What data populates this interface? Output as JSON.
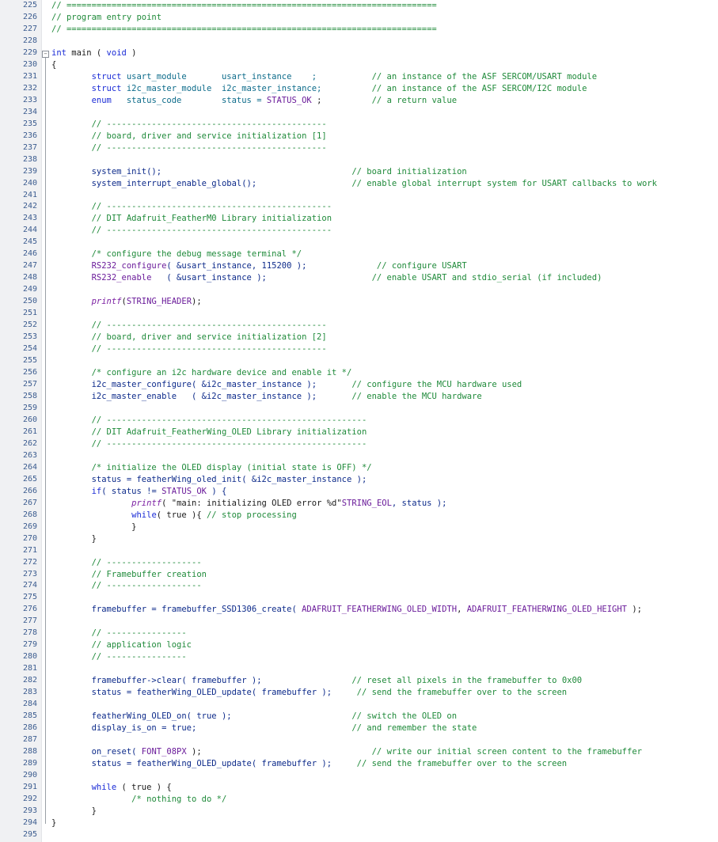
{
  "editor": {
    "lines": [
      {
        "n": "225",
        "tokens": [
          {
            "t": "// ==========================================================================",
            "c": "comment"
          }
        ]
      },
      {
        "n": "226",
        "tokens": [
          {
            "t": "// program entry point",
            "c": "comment"
          }
        ]
      },
      {
        "n": "227",
        "tokens": [
          {
            "t": "// ==========================================================================",
            "c": "comment"
          }
        ]
      },
      {
        "n": "228",
        "tokens": []
      },
      {
        "n": "229",
        "fold": "−",
        "tokens": [
          {
            "t": "int",
            "c": "keyword"
          },
          {
            "t": " main ( ",
            "c": "ident"
          },
          {
            "t": "void",
            "c": "keyword"
          },
          {
            "t": " )",
            "c": "ident"
          }
        ]
      },
      {
        "n": "230",
        "tokens": [
          {
            "t": "{",
            "c": "ident"
          }
        ]
      },
      {
        "n": "231",
        "tokens": [
          {
            "t": "        ",
            "c": "ident"
          },
          {
            "t": "struct",
            "c": "keyword"
          },
          {
            "t": " usart_module       usart_instance    ;           ",
            "c": "type"
          },
          {
            "t": "// an instance of the ASF SERCOM/USART module",
            "c": "comment"
          }
        ]
      },
      {
        "n": "232",
        "tokens": [
          {
            "t": "        ",
            "c": "ident"
          },
          {
            "t": "struct",
            "c": "keyword"
          },
          {
            "t": " i2c_master_module  i2c_master_instance;          ",
            "c": "type"
          },
          {
            "t": "// an instance of the ASF SERCOM/I2C module",
            "c": "comment"
          }
        ]
      },
      {
        "n": "233",
        "tokens": [
          {
            "t": "        ",
            "c": "ident"
          },
          {
            "t": "enum",
            "c": "keyword"
          },
          {
            "t": "   status_code        status = ",
            "c": "type"
          },
          {
            "t": "STATUS_OK",
            "c": "macro"
          },
          {
            "t": " ;          ",
            "c": "ident"
          },
          {
            "t": "// a return value",
            "c": "comment"
          }
        ]
      },
      {
        "n": "234",
        "tokens": []
      },
      {
        "n": "235",
        "tokens": [
          {
            "t": "        ",
            "c": "ident"
          },
          {
            "t": "// --------------------------------------------",
            "c": "comment"
          }
        ]
      },
      {
        "n": "236",
        "tokens": [
          {
            "t": "        ",
            "c": "ident"
          },
          {
            "t": "// board, driver and service initialization [1]",
            "c": "comment"
          }
        ]
      },
      {
        "n": "237",
        "tokens": [
          {
            "t": "        ",
            "c": "ident"
          },
          {
            "t": "// --------------------------------------------",
            "c": "comment"
          }
        ]
      },
      {
        "n": "238",
        "tokens": []
      },
      {
        "n": "239",
        "tokens": [
          {
            "t": "        ",
            "c": "ident"
          },
          {
            "t": "system_init();                                      ",
            "c": "field"
          },
          {
            "t": "// board initialization",
            "c": "comment"
          }
        ]
      },
      {
        "n": "240",
        "tokens": [
          {
            "t": "        ",
            "c": "ident"
          },
          {
            "t": "system_interrupt_enable_global();                   ",
            "c": "field"
          },
          {
            "t": "// enable global interrupt system for USART callbacks to work",
            "c": "comment"
          }
        ]
      },
      {
        "n": "241",
        "tokens": []
      },
      {
        "n": "242",
        "tokens": [
          {
            "t": "        ",
            "c": "ident"
          },
          {
            "t": "// ---------------------------------------------",
            "c": "comment"
          }
        ]
      },
      {
        "n": "243",
        "tokens": [
          {
            "t": "        ",
            "c": "ident"
          },
          {
            "t": "// DIT Adafruit_FeatherM0 Library initialization",
            "c": "comment"
          }
        ]
      },
      {
        "n": "244",
        "tokens": [
          {
            "t": "        ",
            "c": "ident"
          },
          {
            "t": "// ---------------------------------------------",
            "c": "comment"
          }
        ]
      },
      {
        "n": "245",
        "tokens": []
      },
      {
        "n": "246",
        "tokens": [
          {
            "t": "        ",
            "c": "ident"
          },
          {
            "t": "/* configure the debug message terminal */",
            "c": "comment"
          }
        ]
      },
      {
        "n": "247",
        "tokens": [
          {
            "t": "        ",
            "c": "ident"
          },
          {
            "t": "RS232_configure",
            "c": "macro"
          },
          {
            "t": "( &usart_instance, 115200 );              ",
            "c": "field"
          },
          {
            "t": "// configure USART",
            "c": "comment"
          }
        ]
      },
      {
        "n": "248",
        "tokens": [
          {
            "t": "        ",
            "c": "ident"
          },
          {
            "t": "RS232_enable",
            "c": "macro"
          },
          {
            "t": "   ( &usart_instance );                     ",
            "c": "field"
          },
          {
            "t": "// enable USART and stdio_serial (if included)",
            "c": "comment"
          }
        ]
      },
      {
        "n": "249",
        "tokens": []
      },
      {
        "n": "250",
        "tokens": [
          {
            "t": "        ",
            "c": "ident"
          },
          {
            "t": "printf",
            "c": "italic"
          },
          {
            "t": "(",
            "c": "ident"
          },
          {
            "t": "STRING_HEADER",
            "c": "macro"
          },
          {
            "t": ");",
            "c": "ident"
          }
        ]
      },
      {
        "n": "251",
        "tokens": []
      },
      {
        "n": "252",
        "tokens": [
          {
            "t": "        ",
            "c": "ident"
          },
          {
            "t": "// --------------------------------------------",
            "c": "comment"
          }
        ]
      },
      {
        "n": "253",
        "tokens": [
          {
            "t": "        ",
            "c": "ident"
          },
          {
            "t": "// board, driver and service initialization [2]",
            "c": "comment"
          }
        ]
      },
      {
        "n": "254",
        "tokens": [
          {
            "t": "        ",
            "c": "ident"
          },
          {
            "t": "// --------------------------------------------",
            "c": "comment"
          }
        ]
      },
      {
        "n": "255",
        "tokens": []
      },
      {
        "n": "256",
        "tokens": [
          {
            "t": "        ",
            "c": "ident"
          },
          {
            "t": "/* configure an i2c hardware device and enable it */",
            "c": "comment"
          }
        ]
      },
      {
        "n": "257",
        "tokens": [
          {
            "t": "        ",
            "c": "ident"
          },
          {
            "t": "i2c_master_configure( &i2c_master_instance );       ",
            "c": "field"
          },
          {
            "t": "// configure the MCU hardware used",
            "c": "comment"
          }
        ]
      },
      {
        "n": "258",
        "tokens": [
          {
            "t": "        ",
            "c": "ident"
          },
          {
            "t": "i2c_master_enable   ( &i2c_master_instance );       ",
            "c": "field"
          },
          {
            "t": "// enable the MCU hardware",
            "c": "comment"
          }
        ]
      },
      {
        "n": "259",
        "tokens": []
      },
      {
        "n": "260",
        "tokens": [
          {
            "t": "        ",
            "c": "ident"
          },
          {
            "t": "// ----------------------------------------------------",
            "c": "comment"
          }
        ]
      },
      {
        "n": "261",
        "tokens": [
          {
            "t": "        ",
            "c": "ident"
          },
          {
            "t": "// DIT Adafruit_FeatherWing_OLED Library initialization",
            "c": "comment"
          }
        ]
      },
      {
        "n": "262",
        "tokens": [
          {
            "t": "        ",
            "c": "ident"
          },
          {
            "t": "// ----------------------------------------------------",
            "c": "comment"
          }
        ]
      },
      {
        "n": "263",
        "tokens": []
      },
      {
        "n": "264",
        "tokens": [
          {
            "t": "        ",
            "c": "ident"
          },
          {
            "t": "/* initialize the OLED display (initial state is OFF) */",
            "c": "comment"
          }
        ]
      },
      {
        "n": "265",
        "tokens": [
          {
            "t": "        ",
            "c": "ident"
          },
          {
            "t": "status = featherWing_oled_init( &i2c_master_instance );",
            "c": "field"
          }
        ]
      },
      {
        "n": "266",
        "tokens": [
          {
            "t": "        ",
            "c": "ident"
          },
          {
            "t": "if",
            "c": "keyword"
          },
          {
            "t": "( status != ",
            "c": "field"
          },
          {
            "t": "STATUS_OK",
            "c": "macro"
          },
          {
            "t": " ) {",
            "c": "field"
          }
        ]
      },
      {
        "n": "267",
        "tokens": [
          {
            "t": "                ",
            "c": "ident"
          },
          {
            "t": "printf",
            "c": "italic"
          },
          {
            "t": "( ",
            "c": "ident"
          },
          {
            "t": "\"main: initializing OLED error %d\"",
            "c": "ident"
          },
          {
            "t": "STRING_EOL",
            "c": "macro"
          },
          {
            "t": ", status );",
            "c": "field"
          }
        ]
      },
      {
        "n": "268",
        "tokens": [
          {
            "t": "                ",
            "c": "ident"
          },
          {
            "t": "while",
            "c": "keyword"
          },
          {
            "t": "( true ){ ",
            "c": "ident"
          },
          {
            "t": "// stop processing",
            "c": "comment"
          }
        ]
      },
      {
        "n": "269",
        "tokens": [
          {
            "t": "                }",
            "c": "ident"
          }
        ]
      },
      {
        "n": "270",
        "tokens": [
          {
            "t": "        }",
            "c": "ident"
          }
        ]
      },
      {
        "n": "271",
        "tokens": []
      },
      {
        "n": "272",
        "tokens": [
          {
            "t": "        ",
            "c": "ident"
          },
          {
            "t": "// -------------------",
            "c": "comment"
          }
        ]
      },
      {
        "n": "273",
        "tokens": [
          {
            "t": "        ",
            "c": "ident"
          },
          {
            "t": "// Framebuffer creation",
            "c": "comment"
          }
        ]
      },
      {
        "n": "274",
        "tokens": [
          {
            "t": "        ",
            "c": "ident"
          },
          {
            "t": "// -------------------",
            "c": "comment"
          }
        ]
      },
      {
        "n": "275",
        "tokens": []
      },
      {
        "n": "276",
        "tokens": [
          {
            "t": "        ",
            "c": "ident"
          },
          {
            "t": "framebuffer = framebuffer_SSD1306_create( ",
            "c": "field"
          },
          {
            "t": "ADAFRUIT_FEATHERWING_OLED_WIDTH",
            "c": "macro"
          },
          {
            "t": ", ",
            "c": "ident"
          },
          {
            "t": "ADAFRUIT_FEATHERWING_OLED_HEIGHT",
            "c": "macro"
          },
          {
            "t": " );",
            "c": "ident"
          }
        ]
      },
      {
        "n": "277",
        "tokens": []
      },
      {
        "n": "278",
        "tokens": [
          {
            "t": "        ",
            "c": "ident"
          },
          {
            "t": "// ----------------",
            "c": "comment"
          }
        ]
      },
      {
        "n": "279",
        "tokens": [
          {
            "t": "        ",
            "c": "ident"
          },
          {
            "t": "// application logic",
            "c": "comment"
          }
        ]
      },
      {
        "n": "280",
        "tokens": [
          {
            "t": "        ",
            "c": "ident"
          },
          {
            "t": "// ----------------",
            "c": "comment"
          }
        ]
      },
      {
        "n": "281",
        "tokens": []
      },
      {
        "n": "282",
        "tokens": [
          {
            "t": "        ",
            "c": "ident"
          },
          {
            "t": "framebuffer->clear( framebuffer );                  ",
            "c": "field"
          },
          {
            "t": "// reset all pixels in the framebuffer to 0x00",
            "c": "comment"
          }
        ]
      },
      {
        "n": "283",
        "tokens": [
          {
            "t": "        ",
            "c": "ident"
          },
          {
            "t": "status = featherWing_OLED_update( framebuffer );     ",
            "c": "field"
          },
          {
            "t": "// send the framebuffer over to the screen",
            "c": "comment"
          }
        ]
      },
      {
        "n": "284",
        "tokens": []
      },
      {
        "n": "285",
        "tokens": [
          {
            "t": "        ",
            "c": "ident"
          },
          {
            "t": "featherWing_OLED_on( true );                        ",
            "c": "field"
          },
          {
            "t": "// switch the OLED on",
            "c": "comment"
          }
        ]
      },
      {
        "n": "286",
        "tokens": [
          {
            "t": "        ",
            "c": "ident"
          },
          {
            "t": "display_is_on = true;                               ",
            "c": "field"
          },
          {
            "t": "// and remember the state",
            "c": "comment"
          }
        ]
      },
      {
        "n": "287",
        "tokens": []
      },
      {
        "n": "288",
        "tokens": [
          {
            "t": "        ",
            "c": "ident"
          },
          {
            "t": "on_reset( ",
            "c": "field"
          },
          {
            "t": "FONT_08PX",
            "c": "macro"
          },
          {
            "t": " );                                  ",
            "c": "ident"
          },
          {
            "t": "// write our initial screen content to the framebuffer",
            "c": "comment"
          }
        ]
      },
      {
        "n": "289",
        "tokens": [
          {
            "t": "        ",
            "c": "ident"
          },
          {
            "t": "status = featherWing_OLED_update( framebuffer );     ",
            "c": "field"
          },
          {
            "t": "// send the framebuffer over to the screen",
            "c": "comment"
          }
        ]
      },
      {
        "n": "290",
        "tokens": []
      },
      {
        "n": "291",
        "tokens": [
          {
            "t": "        ",
            "c": "ident"
          },
          {
            "t": "while",
            "c": "keyword"
          },
          {
            "t": " ( true ) {",
            "c": "ident"
          }
        ]
      },
      {
        "n": "292",
        "tokens": [
          {
            "t": "                ",
            "c": "ident"
          },
          {
            "t": "/* nothing to do */",
            "c": "comment"
          }
        ]
      },
      {
        "n": "293",
        "tokens": [
          {
            "t": "        }",
            "c": "ident"
          }
        ]
      },
      {
        "n": "294",
        "tokens": [
          {
            "t": "}",
            "c": "ident"
          }
        ]
      },
      {
        "n": "295",
        "tokens": []
      }
    ]
  },
  "colors": {
    "comment": "#1f8a3a",
    "keyword": "#1a2bd6",
    "macro": "#6a1b9a",
    "line_number": "#3b5c8f",
    "gutter_bg": "#f0f1f3"
  },
  "icons": {
    "fold": "fold-toggle-icon"
  }
}
